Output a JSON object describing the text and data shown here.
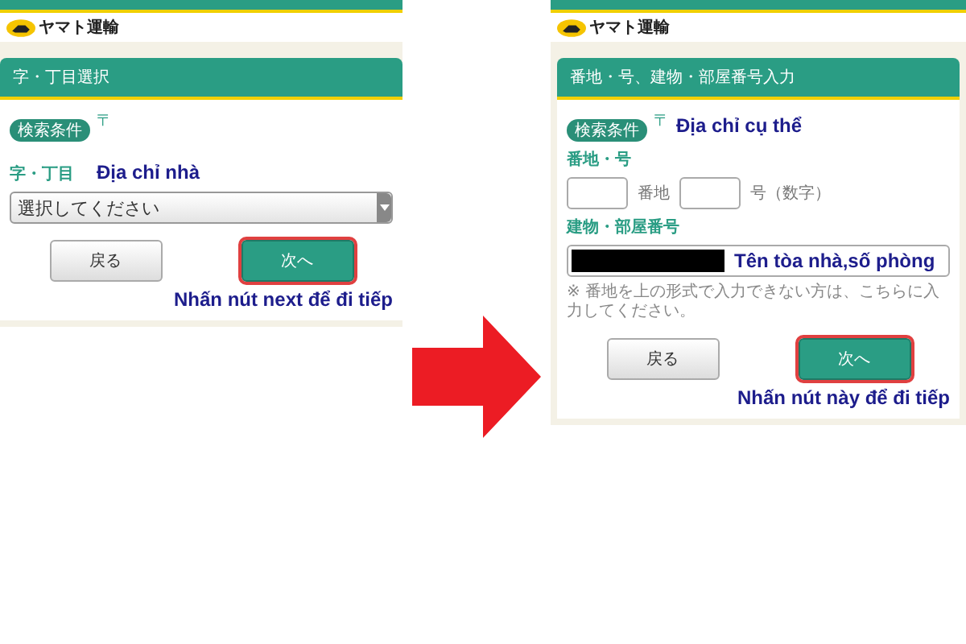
{
  "left_screen": {
    "logo": "ヤマト運輸",
    "section_title": "字・丁目選択",
    "badge": "検索条件",
    "postal_mark": "〒",
    "field_label": "字・丁目",
    "annotation": "Địa chỉ nhà",
    "select_value": "選択してください",
    "buttons": [
      {
        "label": "戻る",
        "kind": "back",
        "highlighted": false
      },
      {
        "label": "次へ",
        "kind": "next",
        "highlighted": true
      }
    ],
    "note": "Nhấn nút next để đi tiếp"
  },
  "right_screen": {
    "logo": "ヤマト運輸",
    "section_title": "番地・号、建物・部屋番号入力",
    "badge": "検索条件",
    "postal_mark": "〒",
    "annotation": "Địa chỉ cụ thể",
    "number_label": "番地・号",
    "number_units": [
      "番地",
      "号（数字）"
    ],
    "building_label": "建物・部屋番号",
    "building_value": "Tên tòa nhà,số phòng",
    "building_redacted": true,
    "hint": "※ 番地を上の形式で入力できない方は、こちらに入力してください。",
    "buttons": [
      {
        "label": "戻る",
        "kind": "back",
        "highlighted": false
      },
      {
        "label": "次へ",
        "kind": "next",
        "highlighted": true
      }
    ],
    "note": "Nhấn nút này để đi tiếp"
  }
}
